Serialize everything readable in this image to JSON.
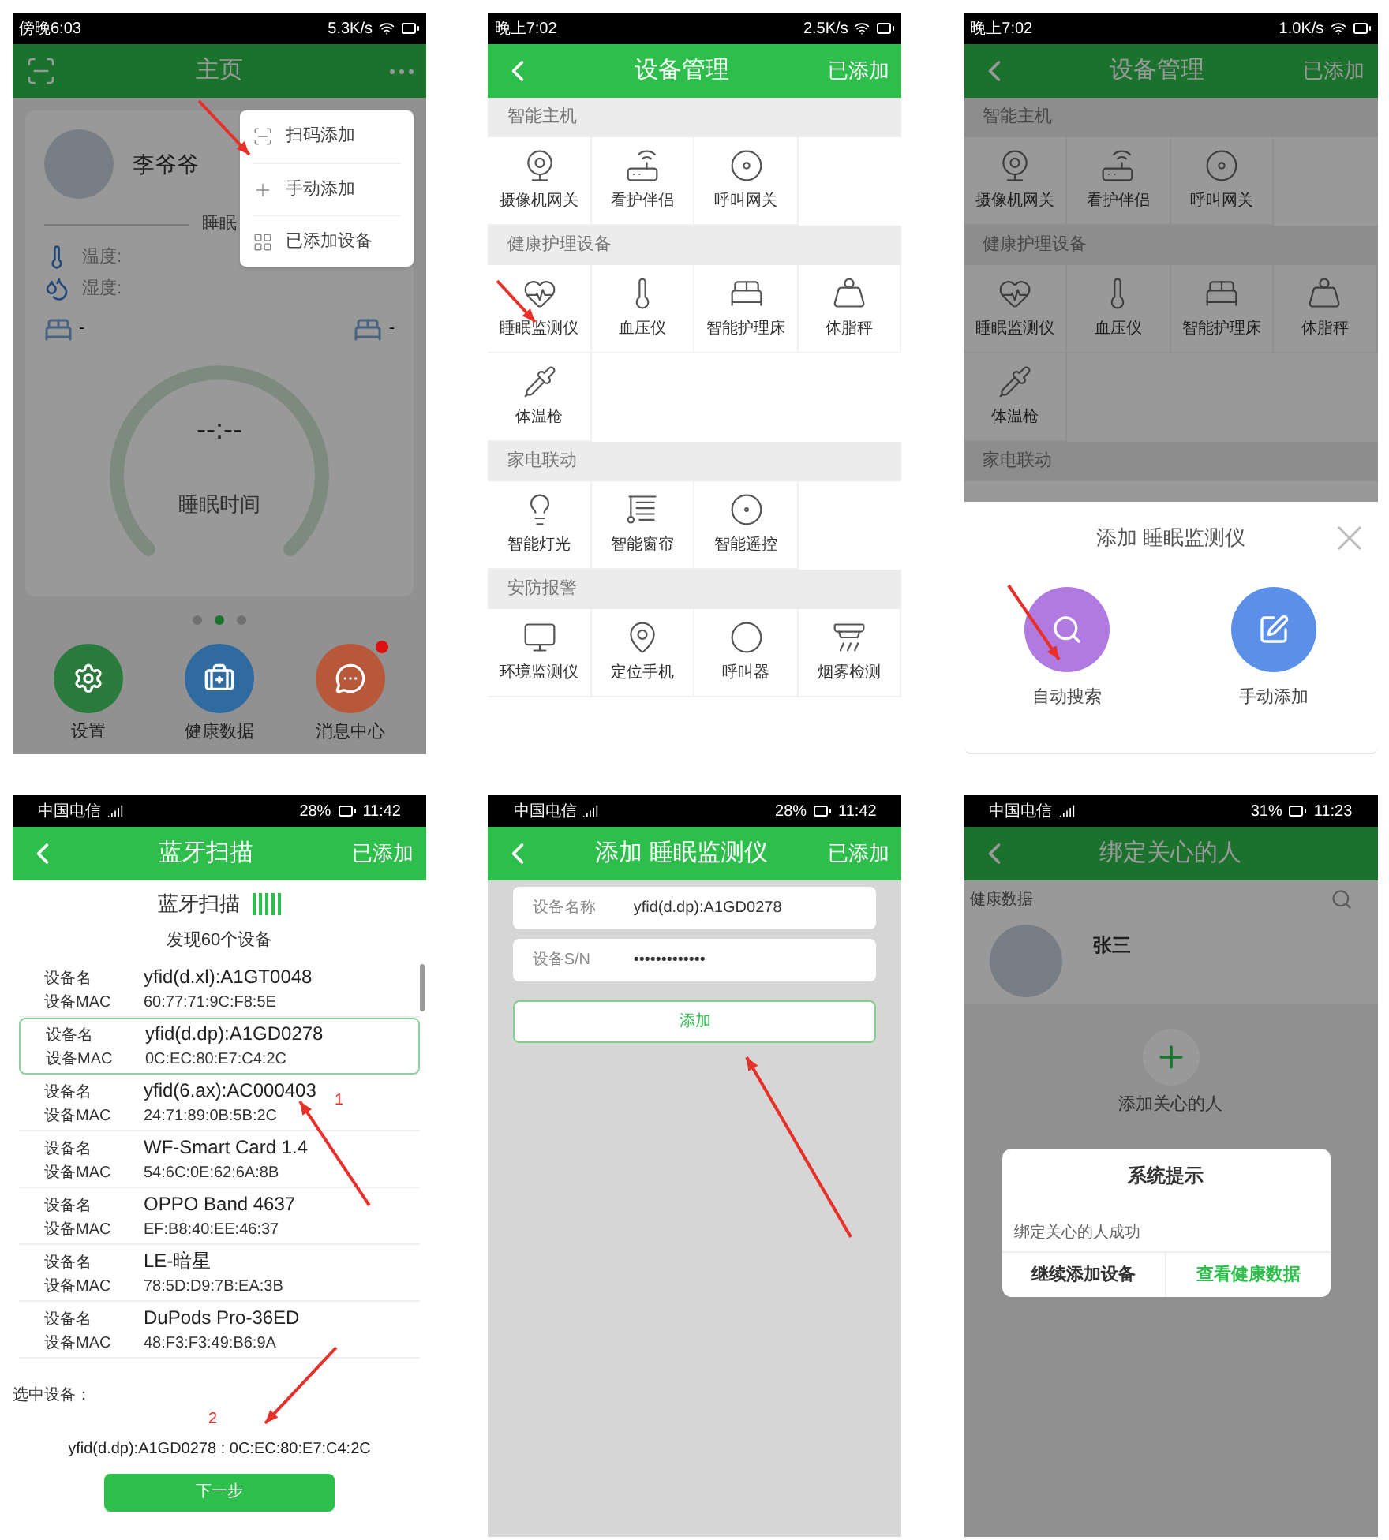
{
  "screens": [
    {
      "kind": "home",
      "status_bar": {
        "kind": "clock",
        "left": "傍晚6:03",
        "right": "5.3K/s"
      },
      "header": {
        "title": "主页"
      },
      "menu": [
        "扫码添加",
        "手动添加",
        "已添加设备"
      ],
      "user": {
        "name": "李爷爷"
      },
      "section_label": "睡眠",
      "readings": [
        "温度:",
        "湿度:"
      ],
      "bed_left": "-",
      "bed_right": "-",
      "gauge": {
        "value": "--:--",
        "label": "睡眠时间"
      },
      "pager": [
        {
          "selected": false
        },
        {
          "selected": true
        },
        {
          "selected": false
        }
      ],
      "actions": [
        {
          "label": "设置",
          "color": "#2a7a3d",
          "badge": false
        },
        {
          "label": "健康数据",
          "color": "#2f6aa0",
          "badge": false
        },
        {
          "label": "消息中心",
          "color": "#b8583a",
          "badge": true
        }
      ]
    },
    {
      "kind": "catalog",
      "status_bar": {
        "kind": "clock",
        "left": "晚上7:02",
        "right": "2.5K/s"
      },
      "header": {
        "title": "设备管理",
        "action": "已添加"
      },
      "sections": [
        {
          "title": "智能主机",
          "items": [
            "摄像机网关",
            "看护伴侣",
            "呼叫网关"
          ]
        },
        {
          "title": "健康护理设备",
          "items": [
            "睡眠监测仪",
            "血压仪",
            "智能护理床",
            "体脂秤",
            "体温枪"
          ]
        },
        {
          "title": "家电联动",
          "items": [
            "智能灯光",
            "智能窗帘",
            "智能遥控"
          ]
        },
        {
          "title": "安防报警",
          "items": [
            "环境监测仪",
            "定位手机",
            "呼叫器",
            "烟雾检测"
          ]
        }
      ]
    },
    {
      "kind": "catalog_sheet",
      "status_bar": {
        "kind": "clock",
        "left": "晚上7:02",
        "right": "1.0K/s"
      },
      "header": {
        "title": "设备管理",
        "action": "已添加"
      },
      "sections": [
        {
          "title": "智能主机",
          "items": [
            "摄像机网关",
            "看护伴侣",
            "呼叫网关"
          ]
        },
        {
          "title": "健康护理设备",
          "items": [
            "睡眠监测仪",
            "血压仪",
            "智能护理床",
            "体脂秤",
            "体温枪"
          ]
        },
        {
          "title": "家电联动"
        }
      ],
      "sheet": {
        "title": "添加 睡眠监测仪",
        "options": [
          {
            "label": "自动搜索",
            "color": "#b07ae0"
          },
          {
            "label": "手动添加",
            "color": "#5b8fe8"
          }
        ]
      }
    },
    {
      "kind": "scan",
      "status_bar": {
        "kind": "carrier",
        "left": "中国电信",
        "battery": "28%",
        "time": "11:42"
      },
      "header": {
        "title": "蓝牙扫描",
        "action": "已添加"
      },
      "scan_label": "蓝牙扫描",
      "found": "发现60个设备",
      "devices": [
        {
          "name_label": "设备名",
          "name": "yfid(d.xl):A1GT0048",
          "mac_label": "设备MAC",
          "mac": "60:77:71:9C:F8:5E",
          "selected": false
        },
        {
          "name_label": "设备名",
          "name": "yfid(d.dp):A1GD0278",
          "mac_label": "设备MAC",
          "mac": "0C:EC:80:E7:C4:2C",
          "selected": true
        },
        {
          "name_label": "设备名",
          "name": "yfid(6.ax):AC000403",
          "mac_label": "设备MAC",
          "mac": "24:71:89:0B:5B:2C",
          "selected": false
        },
        {
          "name_label": "设备名",
          "name": "WF-Smart Card 1.4",
          "mac_label": "设备MAC",
          "mac": "54:6C:0E:62:6A:8B",
          "selected": false
        },
        {
          "name_label": "设备名",
          "name": "OPPO Band 4637",
          "mac_label": "设备MAC",
          "mac": "EF:B8:40:EE:46:37",
          "selected": false
        },
        {
          "name_label": "设备名",
          "name": "LE-暗星",
          "mac_label": "设备MAC",
          "mac": "78:5D:D9:7B:EA:3B",
          "selected": false
        },
        {
          "name_label": "设备名",
          "name": "DuPods Pro-36ED",
          "mac_label": "设备MAC",
          "mac": "48:F3:F3:49:B6:9A",
          "selected": false
        }
      ],
      "selected_label": "选中设备：",
      "selected_value": "yfid(d.dp):A1GD0278 : 0C:EC:80:E7:C4:2C",
      "step_marks": [
        "1",
        "2"
      ],
      "button": "下一步"
    },
    {
      "kind": "form",
      "status_bar": {
        "kind": "carrier",
        "left": "中国电信",
        "battery": "28%",
        "time": "11:42"
      },
      "header": {
        "title": "添加 睡眠监测仪",
        "action": "已添加"
      },
      "fields": [
        {
          "label": "设备名称",
          "value": "yfid(d.dp):A1GD0278"
        },
        {
          "label": "设备S/N",
          "value": "•••••••••••••"
        }
      ],
      "button": "添加"
    },
    {
      "kind": "bind",
      "status_bar": {
        "kind": "carrier",
        "left": "中国电信",
        "battery": "31%",
        "time": "11:23"
      },
      "header": {
        "title": "绑定关心的人"
      },
      "breadcrumb": "健康数据",
      "person": "张三",
      "add_label": "添加关心的人",
      "dialog": {
        "title": "系统提示",
        "message": "绑定关心的人成功",
        "buttons": [
          {
            "label": "继续添加设备",
            "primary": false
          },
          {
            "label": "查看健康数据",
            "primary": true
          }
        ]
      }
    }
  ]
}
